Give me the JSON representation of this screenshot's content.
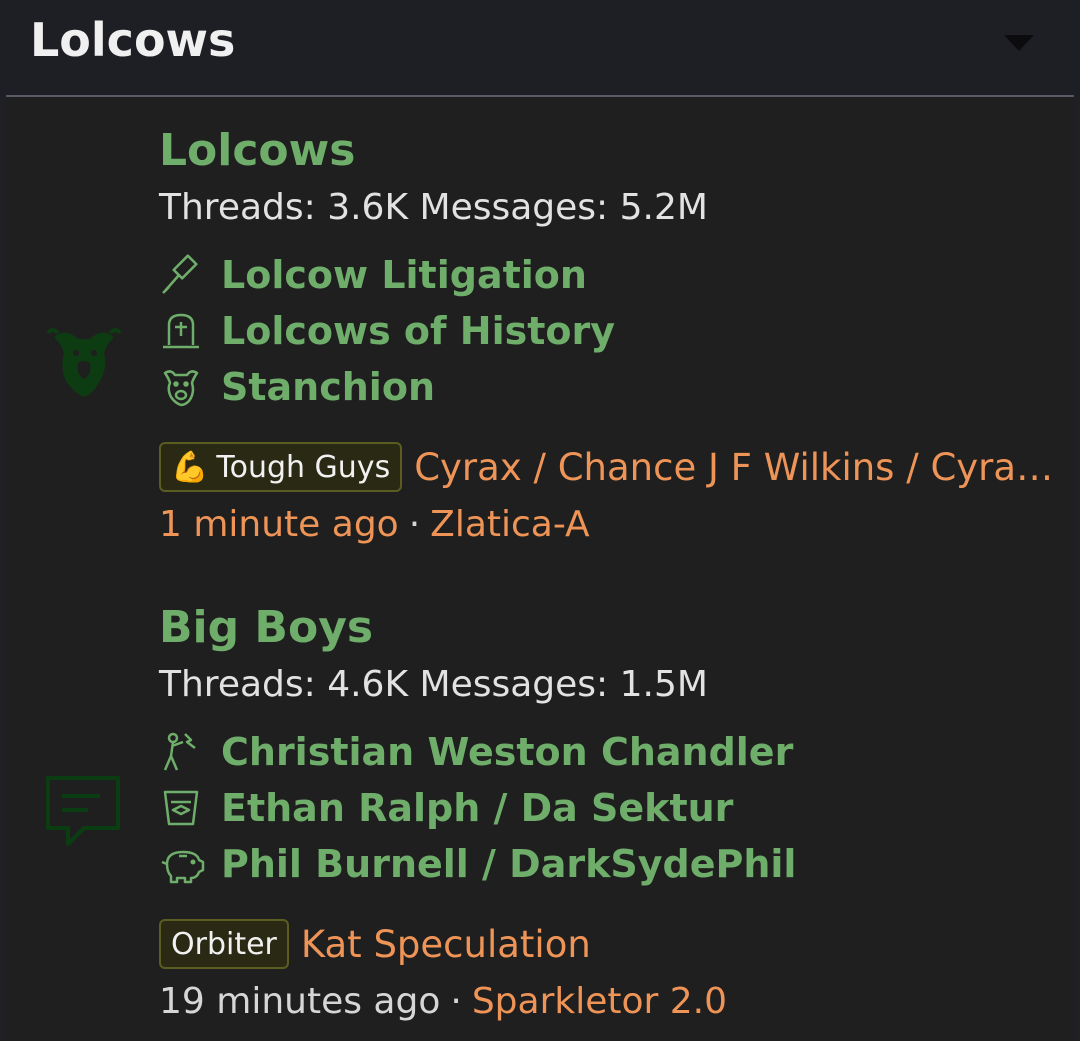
{
  "category": {
    "title": "Lolcows",
    "toggle_icon": "chevron-down-icon"
  },
  "colors": {
    "link_green": "#6fae6a",
    "accent_orange": "#ee9457",
    "background": "#1f1f1f",
    "header_bg": "#1e1f25",
    "icon_dark_green": "#0b3d12"
  },
  "nodes": [
    {
      "title": "Lolcows",
      "icon": "cow-head-icon",
      "stats": "Threads: 3.6K Messages: 5.2M",
      "subforums": [
        {
          "label": "Lolcow Litigation",
          "icon": "gavel-icon"
        },
        {
          "label": "Lolcows of History",
          "icon": "tombstone-icon"
        },
        {
          "label": "Stanchion",
          "icon": "cow-head-icon"
        }
      ],
      "latest": {
        "prefix": "Tough Guys",
        "prefix_emoji": "💪",
        "title": "Cyrax / Chance J F Wilkins / Cyrax Meister / Cyrax",
        "time": "1 minute ago",
        "separator": "·",
        "user": "Zlatica-A"
      }
    },
    {
      "title": "Big Boys",
      "icon": "speech-bubble-icon",
      "stats": "Threads: 4.6K Messages: 1.5M",
      "subforums": [
        {
          "label": "Christian Weston Chandler",
          "icon": "person-lightning-icon"
        },
        {
          "label": "Ethan Ralph / Da Sektur",
          "icon": "glass-ticket-icon"
        },
        {
          "label": "Phil Burnell / DarkSydePhil",
          "icon": "piggy-bank-icon"
        }
      ],
      "latest": {
        "prefix": "Orbiter",
        "title": "Kat Speculation",
        "time": "19 minutes ago",
        "separator": "·",
        "user": "Sparkletor 2.0"
      }
    }
  ]
}
